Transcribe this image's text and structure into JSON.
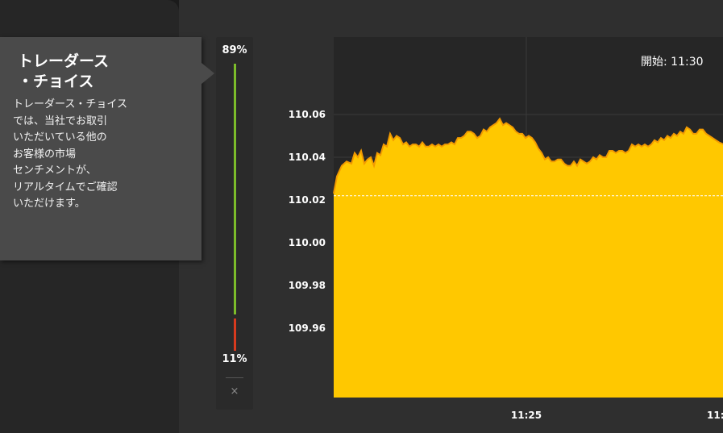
{
  "tooltip": {
    "title": "トレーダース\n・チョイス",
    "body": "トレーダース・チョイス\nでは、当社でお取引\nいただいている他の\nお客様の市場\nセンチメントが、\nリアルタイムでご確認\nいただけます。"
  },
  "sentiment": {
    "up_percent": "89%",
    "down_percent": "11%",
    "close_label": "×",
    "up_color": "#7cbc2a",
    "down_color": "#d73a1e"
  },
  "chart": {
    "start_label": "開始: 11:30"
  },
  "chart_data": {
    "type": "area",
    "color": "#ffc800",
    "line_color": "#f29a00",
    "reference_value": 110.022,
    "y_ticks": [
      "110.06",
      "110.04",
      "110.02",
      "110.00",
      "109.98",
      "109.96"
    ],
    "x_ticks": [
      "11:25",
      "11:"
    ],
    "grid": true,
    "points": [
      [
        0,
        110.023
      ],
      [
        4,
        110.031
      ],
      [
        10,
        110.036
      ],
      [
        16,
        110.038
      ],
      [
        22,
        110.037
      ],
      [
        26,
        110.042
      ],
      [
        30,
        110.04
      ],
      [
        34,
        110.043
      ],
      [
        38,
        110.037
      ],
      [
        42,
        110.039
      ],
      [
        46,
        110.04
      ],
      [
        50,
        110.036
      ],
      [
        54,
        110.042
      ],
      [
        58,
        110.041
      ],
      [
        62,
        110.046
      ],
      [
        66,
        110.045
      ],
      [
        70,
        110.051
      ],
      [
        74,
        110.048
      ],
      [
        78,
        110.05
      ],
      [
        82,
        110.049
      ],
      [
        86,
        110.046
      ],
      [
        90,
        110.047
      ],
      [
        94,
        110.045
      ],
      [
        98,
        110.046
      ],
      [
        102,
        110.046
      ],
      [
        106,
        110.045
      ],
      [
        110,
        110.047
      ],
      [
        114,
        110.045
      ],
      [
        118,
        110.045
      ],
      [
        122,
        110.046
      ],
      [
        126,
        110.045
      ],
      [
        130,
        110.046
      ],
      [
        134,
        110.045
      ],
      [
        138,
        110.046
      ],
      [
        142,
        110.046
      ],
      [
        146,
        110.047
      ],
      [
        150,
        110.046
      ],
      [
        154,
        110.049
      ],
      [
        158,
        110.049
      ],
      [
        162,
        110.05
      ],
      [
        166,
        110.052
      ],
      [
        170,
        110.052
      ],
      [
        174,
        110.051
      ],
      [
        178,
        110.049
      ],
      [
        182,
        110.05
      ],
      [
        186,
        110.053
      ],
      [
        190,
        110.052
      ],
      [
        194,
        110.054
      ],
      [
        198,
        110.055
      ],
      [
        202,
        110.056
      ],
      [
        206,
        110.058
      ],
      [
        210,
        110.055
      ],
      [
        214,
        110.056
      ],
      [
        218,
        110.055
      ],
      [
        222,
        110.054
      ],
      [
        226,
        110.052
      ],
      [
        230,
        110.051
      ],
      [
        234,
        110.051
      ],
      [
        238,
        110.049
      ],
      [
        242,
        110.05
      ],
      [
        246,
        110.049
      ],
      [
        250,
        110.047
      ],
      [
        254,
        110.044
      ],
      [
        258,
        110.042
      ],
      [
        262,
        110.039
      ],
      [
        266,
        110.04
      ],
      [
        270,
        110.038
      ],
      [
        274,
        110.038
      ],
      [
        278,
        110.039
      ],
      [
        282,
        110.039
      ],
      [
        286,
        110.037
      ],
      [
        290,
        110.036
      ],
      [
        294,
        110.036
      ],
      [
        298,
        110.038
      ],
      [
        302,
        110.036
      ],
      [
        306,
        110.039
      ],
      [
        310,
        110.038
      ],
      [
        314,
        110.037
      ],
      [
        318,
        110.038
      ],
      [
        322,
        110.04
      ],
      [
        326,
        110.039
      ],
      [
        330,
        110.041
      ],
      [
        334,
        110.04
      ],
      [
        338,
        110.04
      ],
      [
        342,
        110.043
      ],
      [
        346,
        110.043
      ],
      [
        350,
        110.042
      ],
      [
        354,
        110.043
      ],
      [
        358,
        110.043
      ],
      [
        362,
        110.042
      ],
      [
        366,
        110.043
      ],
      [
        370,
        110.046
      ],
      [
        374,
        110.045
      ],
      [
        378,
        110.046
      ],
      [
        382,
        110.045
      ],
      [
        386,
        110.046
      ],
      [
        390,
        110.045
      ],
      [
        394,
        110.046
      ],
      [
        398,
        110.048
      ],
      [
        402,
        110.047
      ],
      [
        406,
        110.049
      ],
      [
        410,
        110.048
      ],
      [
        414,
        110.05
      ],
      [
        418,
        110.049
      ],
      [
        422,
        110.051
      ],
      [
        426,
        110.05
      ],
      [
        430,
        110.052
      ],
      [
        434,
        110.051
      ],
      [
        438,
        110.054
      ],
      [
        442,
        110.053
      ],
      [
        446,
        110.051
      ],
      [
        450,
        110.051
      ],
      [
        454,
        110.053
      ],
      [
        458,
        110.053
      ],
      [
        462,
        110.051
      ],
      [
        466,
        110.05
      ],
      [
        470,
        110.049
      ],
      [
        474,
        110.048
      ],
      [
        478,
        110.047
      ],
      [
        484,
        110.046
      ]
    ]
  }
}
